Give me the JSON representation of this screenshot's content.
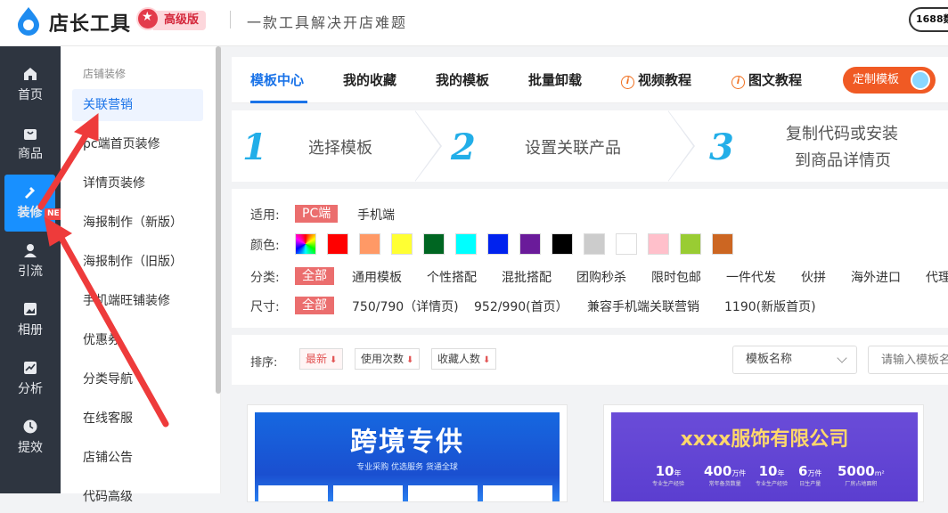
{
  "header": {
    "logo_text": "店长工具",
    "badge": "高级版",
    "slogan": "一款工具解决开店难题",
    "right_pill": "1688数"
  },
  "leftnav": {
    "items": [
      {
        "label": "首页",
        "icon": "home-icon"
      },
      {
        "label": "商品",
        "icon": "bag-icon"
      },
      {
        "label": "装修",
        "icon": "brush-icon",
        "active": true
      },
      {
        "label": "引流",
        "icon": "user-icon"
      },
      {
        "label": "相册",
        "icon": "image-icon"
      },
      {
        "label": "分析",
        "icon": "chart-icon"
      },
      {
        "label": "提效",
        "icon": "clock-icon"
      }
    ],
    "new_tag": "NE"
  },
  "subnav": {
    "title": "店铺装修",
    "items": [
      "关联营销",
      "pc端首页装修",
      "详情页装修",
      "海报制作（新版）",
      "海报制作（旧版）",
      "手机端旺铺装修",
      "优惠券",
      "分类导航",
      "在线客服",
      "店铺公告",
      "代码高级"
    ]
  },
  "tabs": {
    "items": [
      "模板中心",
      "我的收藏",
      "我的模板",
      "批量卸载",
      "视频教程",
      "图文教程"
    ],
    "custom_button": "定制模板"
  },
  "steps": [
    {
      "num": "1",
      "text": "选择模板"
    },
    {
      "num": "2",
      "text": "设置关联产品"
    },
    {
      "num": "3",
      "text_line1": "复制代码或安装",
      "text_line2": "到商品详情页"
    }
  ],
  "filters": {
    "platform_label": "适用:",
    "platform_options": [
      "PC端",
      "手机端"
    ],
    "color_label": "颜色:",
    "colors": [
      "#ff0000",
      "#ff9966",
      "#ffff33",
      "#006622",
      "#00ffff",
      "#0022ee",
      "#6a1b9a",
      "#000000",
      "#cccccc",
      "#ffffff",
      "#ffc0cb",
      "#99cc33",
      "#cc6622"
    ],
    "category_label": "分类:",
    "category_options": [
      "全部",
      "通用模板",
      "个性搭配",
      "混批搭配",
      "团购秒杀",
      "限时包邮",
      "一件代发",
      "伙拼",
      "海外进口",
      "代理"
    ],
    "size_label": "尺寸:",
    "size_options": [
      "全部",
      "750/790（详情页)",
      "952/990(首页）",
      "兼容手机端关联营销",
      "1190(新版首页)"
    ]
  },
  "sortbar": {
    "label": "排序:",
    "options": [
      "最新",
      "使用次数",
      "收藏人数"
    ],
    "select_value": "模板名称",
    "search_placeholder": "请输入模板名"
  },
  "cards": {
    "card1_title": "跨境专供",
    "card1_sub": "专业采购  优选服务  货通全球",
    "card2_title": "xxxx服饰有限公司",
    "card2_stats": [
      {
        "num": "10",
        "unit": "年",
        "cap": "专业生产经验"
      },
      {
        "num": "400",
        "unit": "万件",
        "cap": "常年备货数量"
      },
      {
        "num": "10",
        "unit": "年",
        "cap": "专业生产经验"
      },
      {
        "num": "6",
        "unit": "万件",
        "cap": "日生产量"
      },
      {
        "num": "5000",
        "unit": "m²",
        "cap": "厂房占地面积"
      }
    ]
  },
  "colors": {
    "primary": "#1a73e8",
    "accent": "#f05a24",
    "nav_bg": "#2e3540",
    "annotation_arrow": "#ee3b3b"
  }
}
